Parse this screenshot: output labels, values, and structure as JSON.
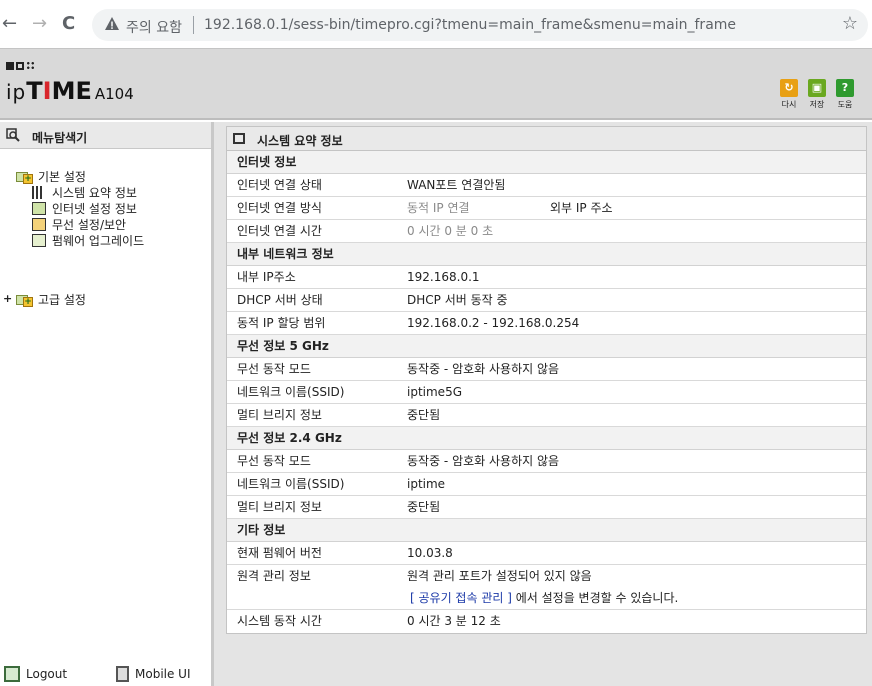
{
  "browser": {
    "back": "←",
    "forward": "→",
    "reload": "C",
    "security_warning": "주의 요함",
    "url": "192.168.0.1/sess-bin/timepro.cgi?tmenu=main_frame&smenu=main_frame",
    "star": "☆"
  },
  "header": {
    "brand_ip": "ip",
    "brand_t": "T",
    "brand_i": "I",
    "brand_me": "ME",
    "model": "A104",
    "tools": [
      {
        "label": "다시",
        "glyph": "↻",
        "color": "#e8a014"
      },
      {
        "label": "저장",
        "glyph": "▣",
        "color": "#6aa820"
      },
      {
        "label": "도움",
        "glyph": "?",
        "color": "#2f9a2f"
      }
    ]
  },
  "sidebar": {
    "title": "메뉴탐색기",
    "basic": {
      "label": "기본 설정",
      "items": [
        "시스템 요약 정보",
        "인터넷 설정 정보",
        "무선 설정/보안",
        "펌웨어 업그레이드"
      ]
    },
    "advanced": {
      "expander": "+",
      "label": "고급 설정"
    },
    "logout": "Logout",
    "mobile": "Mobile UI"
  },
  "main": {
    "title": "시스템 요약 정보",
    "sections": {
      "internet": {
        "title": "인터넷 정보",
        "rows": [
          {
            "k": "인터넷 연결 상태",
            "v": "WAN포트 연결안됨"
          },
          {
            "k": "인터넷 연결 방식",
            "v": "동적 IP 연결",
            "v2": "외부 IP 주소"
          },
          {
            "k": "인터넷 연결 시간",
            "v": "0 시간 0 분 0 초"
          }
        ]
      },
      "lan": {
        "title": "내부 네트워크 정보",
        "rows": [
          {
            "k": "내부 IP주소",
            "v": "192.168.0.1"
          },
          {
            "k": "DHCP 서버 상태",
            "v": "DHCP 서버 동작 중"
          },
          {
            "k": "동적 IP 할당 범위",
            "v": "192.168.0.2 -  192.168.0.254"
          }
        ]
      },
      "wifi5": {
        "title": "무선 정보 5 GHz",
        "rows": [
          {
            "k": "무선 동작 모드",
            "v": "동작중 - 암호화 사용하지 않음"
          },
          {
            "k": "네트워크 이름(SSID)",
            "v": "iptime5G"
          },
          {
            "k": "멀티 브리지 정보",
            "v": "중단됨"
          }
        ]
      },
      "wifi24": {
        "title": "무선 정보 2.4 GHz",
        "rows": [
          {
            "k": "무선 동작 모드",
            "v": "동작중 - 암호화 사용하지 않음"
          },
          {
            "k": "네트워크 이름(SSID)",
            "v": "iptime"
          },
          {
            "k": "멀티 브리지 정보",
            "v": "중단됨"
          }
        ]
      },
      "etc": {
        "title": "기타 정보",
        "rows": [
          {
            "k": "현재 펌웨어 버전",
            "v": "10.03.8"
          },
          {
            "k": "원격 관리 정보",
            "v": "원격 관리 포트가 설정되어 있지 않음"
          }
        ],
        "remote_link": "[ 공유기 접속 관리 ]",
        "remote_note": " 에서 설정을 변경할 수 있습니다.",
        "uptime_k": "시스템 동작 시간",
        "uptime_v": "0 시간 3 분 12 초"
      }
    }
  }
}
